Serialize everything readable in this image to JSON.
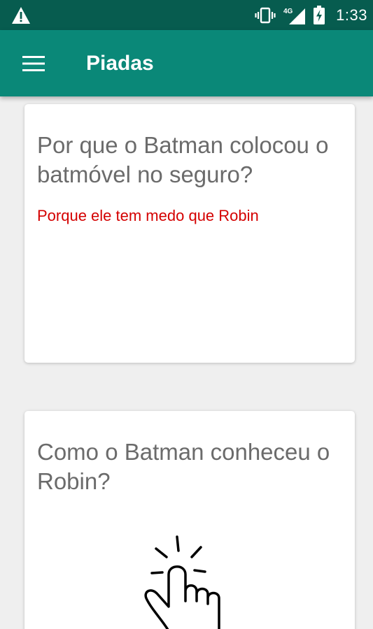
{
  "status_bar": {
    "time": "1:33",
    "network": "4G",
    "icons": [
      "warning-icon",
      "vibrate-icon",
      "signal-icon",
      "battery-icon"
    ]
  },
  "app_bar": {
    "title": "Piadas",
    "menu_icon": "hamburger-menu-icon"
  },
  "jokes": [
    {
      "question": "Por que o Batman colocou o batmóvel no seguro?",
      "answer": "Porque ele tem medo que Robin"
    },
    {
      "question": "Como o Batman conheceu o Robin?",
      "answer": "",
      "hint_icon": "tap-hand-icon"
    }
  ],
  "colors": {
    "status_bar": "#075c4f",
    "app_bar": "#0a8878",
    "background": "#efefef",
    "question_text": "#6b6b6b",
    "answer_text": "#d40000"
  }
}
